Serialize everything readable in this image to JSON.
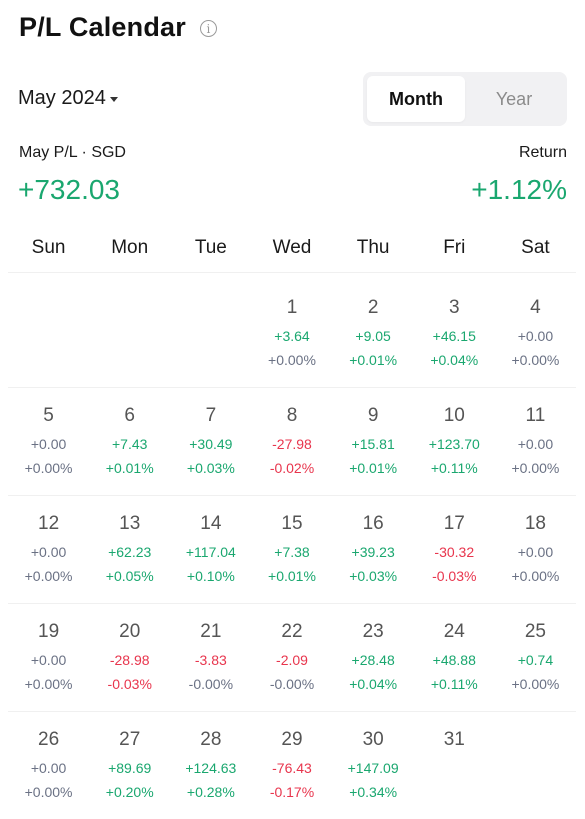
{
  "header": {
    "title": "P/L Calendar",
    "info_icon": "info-icon"
  },
  "month_selector": {
    "label": "May 2024",
    "icon": "caret-down-icon"
  },
  "view_toggle": {
    "options": [
      "Month",
      "Year"
    ],
    "selected": "Month"
  },
  "summary": {
    "pl_label": "May P/L · SGD",
    "pl_value": "+732.03",
    "return_label": "Return",
    "return_value": "+1.12%"
  },
  "colors": {
    "positive": "#1aa76f",
    "negative": "#e8354d",
    "neutral": "#6a7184"
  },
  "weekdays": [
    "Sun",
    "Mon",
    "Tue",
    "Wed",
    "Thu",
    "Fri",
    "Sat"
  ],
  "weeks": [
    [
      null,
      null,
      null,
      {
        "day": "1",
        "pl": "+3.64",
        "pct": "+0.00%",
        "pl_sign": "pos",
        "pct_sign": "zero"
      },
      {
        "day": "2",
        "pl": "+9.05",
        "pct": "+0.01%",
        "pl_sign": "pos",
        "pct_sign": "pos"
      },
      {
        "day": "3",
        "pl": "+46.15",
        "pct": "+0.04%",
        "pl_sign": "pos",
        "pct_sign": "pos"
      },
      {
        "day": "4",
        "pl": "+0.00",
        "pct": "+0.00%",
        "pl_sign": "zero",
        "pct_sign": "zero"
      }
    ],
    [
      {
        "day": "5",
        "pl": "+0.00",
        "pct": "+0.00%",
        "pl_sign": "zero",
        "pct_sign": "zero"
      },
      {
        "day": "6",
        "pl": "+7.43",
        "pct": "+0.01%",
        "pl_sign": "pos",
        "pct_sign": "pos"
      },
      {
        "day": "7",
        "pl": "+30.49",
        "pct": "+0.03%",
        "pl_sign": "pos",
        "pct_sign": "pos"
      },
      {
        "day": "8",
        "pl": "-27.98",
        "pct": "-0.02%",
        "pl_sign": "neg",
        "pct_sign": "neg"
      },
      {
        "day": "9",
        "pl": "+15.81",
        "pct": "+0.01%",
        "pl_sign": "pos",
        "pct_sign": "pos"
      },
      {
        "day": "10",
        "pl": "+123.70",
        "pct": "+0.11%",
        "pl_sign": "pos",
        "pct_sign": "pos"
      },
      {
        "day": "11",
        "pl": "+0.00",
        "pct": "+0.00%",
        "pl_sign": "zero",
        "pct_sign": "zero"
      }
    ],
    [
      {
        "day": "12",
        "pl": "+0.00",
        "pct": "+0.00%",
        "pl_sign": "zero",
        "pct_sign": "zero"
      },
      {
        "day": "13",
        "pl": "+62.23",
        "pct": "+0.05%",
        "pl_sign": "pos",
        "pct_sign": "pos"
      },
      {
        "day": "14",
        "pl": "+117.04",
        "pct": "+0.10%",
        "pl_sign": "pos",
        "pct_sign": "pos"
      },
      {
        "day": "15",
        "pl": "+7.38",
        "pct": "+0.01%",
        "pl_sign": "pos",
        "pct_sign": "pos"
      },
      {
        "day": "16",
        "pl": "+39.23",
        "pct": "+0.03%",
        "pl_sign": "pos",
        "pct_sign": "pos"
      },
      {
        "day": "17",
        "pl": "-30.32",
        "pct": "-0.03%",
        "pl_sign": "neg",
        "pct_sign": "neg"
      },
      {
        "day": "18",
        "pl": "+0.00",
        "pct": "+0.00%",
        "pl_sign": "zero",
        "pct_sign": "zero"
      }
    ],
    [
      {
        "day": "19",
        "pl": "+0.00",
        "pct": "+0.00%",
        "pl_sign": "zero",
        "pct_sign": "zero"
      },
      {
        "day": "20",
        "pl": "-28.98",
        "pct": "-0.03%",
        "pl_sign": "neg",
        "pct_sign": "neg"
      },
      {
        "day": "21",
        "pl": "-3.83",
        "pct": "-0.00%",
        "pl_sign": "neg",
        "pct_sign": "zero"
      },
      {
        "day": "22",
        "pl": "-2.09",
        "pct": "-0.00%",
        "pl_sign": "neg",
        "pct_sign": "zero"
      },
      {
        "day": "23",
        "pl": "+28.48",
        "pct": "+0.04%",
        "pl_sign": "pos",
        "pct_sign": "pos"
      },
      {
        "day": "24",
        "pl": "+48.88",
        "pct": "+0.11%",
        "pl_sign": "pos",
        "pct_sign": "pos"
      },
      {
        "day": "25",
        "pl": "+0.74",
        "pct": "+0.00%",
        "pl_sign": "pos",
        "pct_sign": "zero"
      }
    ],
    [
      {
        "day": "26",
        "pl": "+0.00",
        "pct": "+0.00%",
        "pl_sign": "zero",
        "pct_sign": "zero"
      },
      {
        "day": "27",
        "pl": "+89.69",
        "pct": "+0.20%",
        "pl_sign": "pos",
        "pct_sign": "pos"
      },
      {
        "day": "28",
        "pl": "+124.63",
        "pct": "+0.28%",
        "pl_sign": "pos",
        "pct_sign": "pos"
      },
      {
        "day": "29",
        "pl": "-76.43",
        "pct": "-0.17%",
        "pl_sign": "neg",
        "pct_sign": "neg"
      },
      {
        "day": "30",
        "pl": "+147.09",
        "pct": "+0.34%",
        "pl_sign": "pos",
        "pct_sign": "pos"
      },
      {
        "day": "31",
        "pl": "",
        "pct": "",
        "pl_sign": "zero",
        "pct_sign": "zero"
      },
      null
    ]
  ]
}
